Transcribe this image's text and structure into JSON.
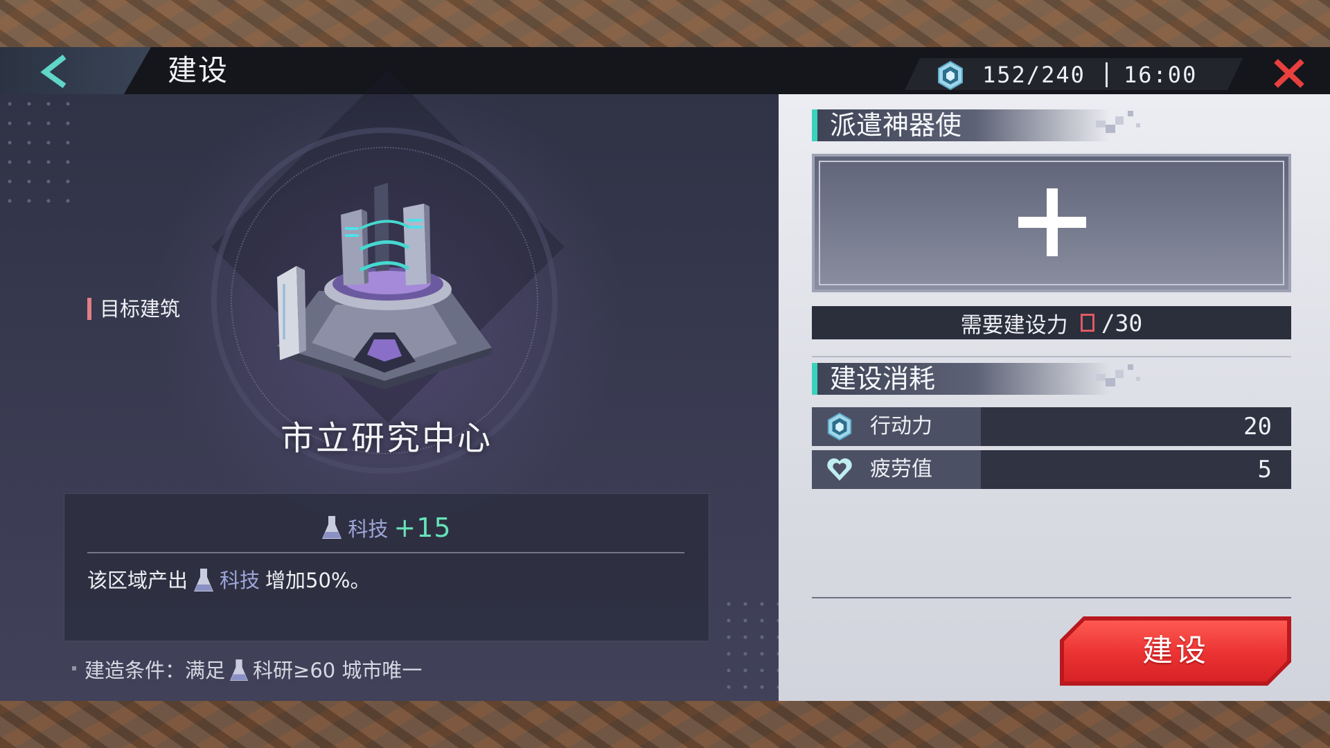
{
  "header": {
    "title": "建设",
    "resource": {
      "icon": "stamina-crystal-icon",
      "count": "152/240"
    },
    "time": "16:00"
  },
  "left": {
    "target_label": "目标建筑",
    "building_name": "市立研究中心",
    "bonus": {
      "icon": "flask-icon",
      "name": "科技",
      "value": "+15"
    },
    "effect": {
      "prefix": "该区域产出",
      "resource": "科技",
      "suffix": "增加50%。"
    },
    "condition": {
      "prefix": "建造条件：满足",
      "requirement": "科研≥60 城市唯一"
    }
  },
  "right": {
    "dispatch_title": "派遣神器使",
    "need": {
      "label": "需要建设力",
      "total": "/30"
    },
    "cost_title": "建设消耗",
    "costs": [
      {
        "icon": "stamina-crystal-icon",
        "name": "行动力",
        "value": "20"
      },
      {
        "icon": "heart-icon",
        "name": "疲劳值",
        "value": "5"
      }
    ],
    "build_button": "建设"
  },
  "colors": {
    "accent_teal": "#38d2bd",
    "close_red": "#e8403e",
    "build_red": "#ea3232",
    "bonus_green": "#67e3b8",
    "resource_purple": "#9ea6d8"
  }
}
